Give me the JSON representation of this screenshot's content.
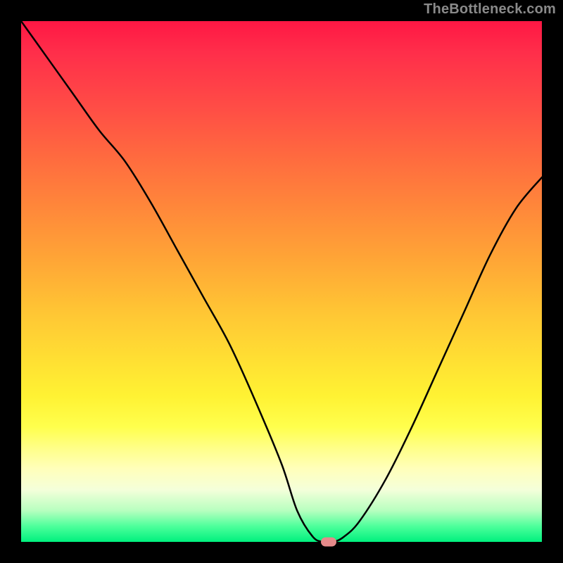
{
  "watermark": "TheBottleneck.com",
  "chart_data": {
    "type": "line",
    "title": "",
    "xlabel": "",
    "ylabel": "",
    "xlim": [
      0,
      100
    ],
    "ylim": [
      0,
      100
    ],
    "grid": false,
    "series": [
      {
        "name": "bottleneck-curve",
        "x": [
          0,
          5,
          10,
          15,
          20,
          25,
          30,
          35,
          40,
          45,
          50,
          53,
          56,
          58,
          60,
          62,
          65,
          70,
          75,
          80,
          85,
          90,
          95,
          100
        ],
        "values": [
          100,
          93,
          86,
          79,
          73,
          65,
          56,
          47,
          38,
          27,
          15,
          6,
          1,
          0,
          0,
          1,
          4,
          12,
          22,
          33,
          44,
          55,
          64,
          70
        ]
      }
    ],
    "marker": {
      "x": 59,
      "y": 0,
      "color": "#e58a8a"
    },
    "gradient_stops": [
      {
        "pos": 0,
        "color": "#ff1744"
      },
      {
        "pos": 50,
        "color": "#ffc634"
      },
      {
        "pos": 80,
        "color": "#ffff66"
      },
      {
        "pos": 100,
        "color": "#00f07e"
      }
    ]
  }
}
